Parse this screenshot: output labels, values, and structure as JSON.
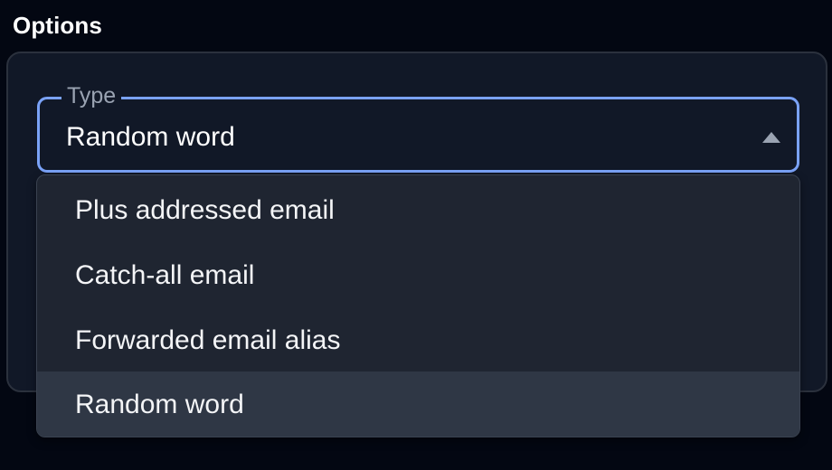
{
  "section": {
    "title": "Options"
  },
  "type_field": {
    "legend": "Type",
    "value": "Random word",
    "arrow_icon": "caret-up-icon",
    "focus_color": "#7aa2f7"
  },
  "dropdown": {
    "options": [
      {
        "label": "Plus addressed email",
        "selected": false
      },
      {
        "label": "Catch-all email",
        "selected": false
      },
      {
        "label": "Forwarded email alias",
        "selected": false
      },
      {
        "label": "Random word",
        "selected": true
      }
    ],
    "highlight_color": "#2f3745"
  }
}
